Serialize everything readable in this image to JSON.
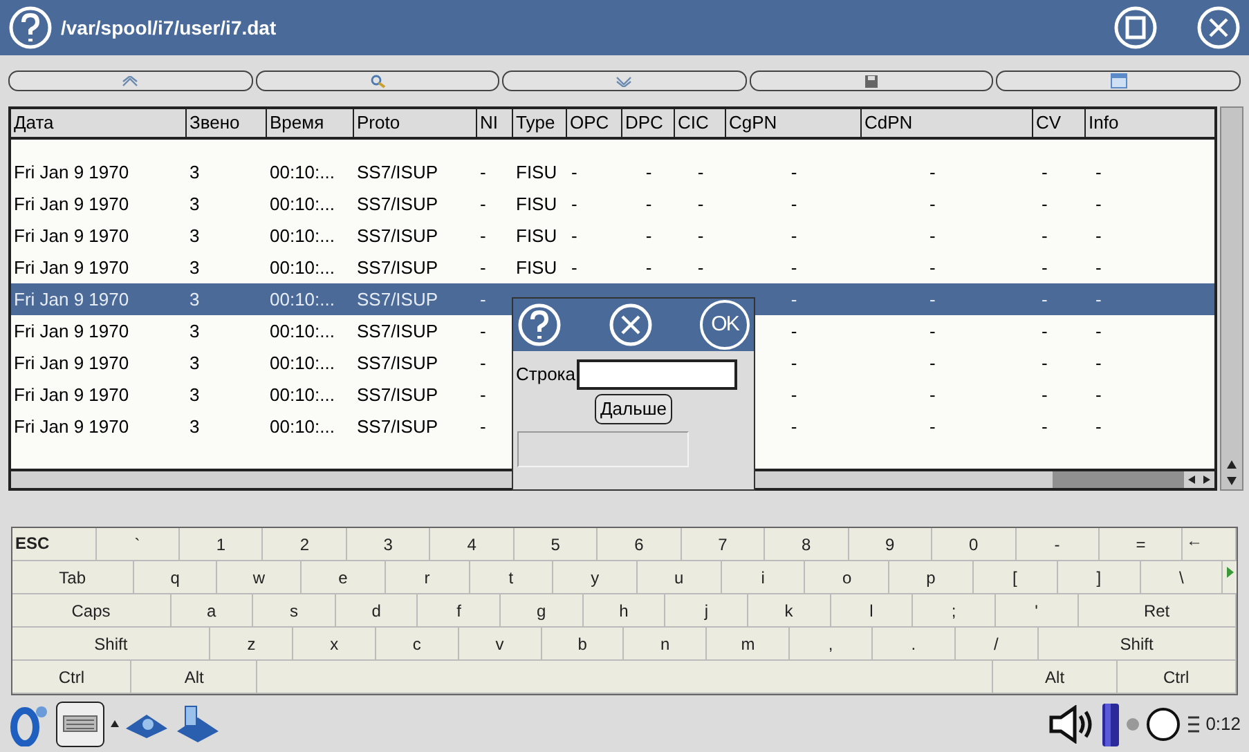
{
  "window": {
    "title": "/var/spool/i7/user/i7.dat"
  },
  "table": {
    "columns": [
      "Дата",
      "Звено",
      "Время",
      "Proto",
      "NI",
      "Type",
      "OPC",
      "DPC",
      "CIC",
      "CgPN",
      "CdPN",
      "CV",
      "Info"
    ],
    "rows": [
      {
        "selected": false,
        "cells": [
          "Fri Jan 9 1970",
          "3",
          "00:10:...",
          "SS7/ISUP",
          "-",
          "FISU",
          "-",
          "-",
          "-",
          "-",
          "-",
          "-",
          "-"
        ]
      },
      {
        "selected": false,
        "cells": [
          "Fri Jan 9 1970",
          "3",
          "00:10:...",
          "SS7/ISUP",
          "-",
          "FISU",
          "-",
          "-",
          "-",
          "-",
          "-",
          "-",
          "-"
        ]
      },
      {
        "selected": false,
        "cells": [
          "Fri Jan 9 1970",
          "3",
          "00:10:...",
          "SS7/ISUP",
          "-",
          "FISU",
          "-",
          "-",
          "-",
          "-",
          "-",
          "-",
          "-"
        ]
      },
      {
        "selected": false,
        "cells": [
          "Fri Jan 9 1970",
          "3",
          "00:10:...",
          "SS7/ISUP",
          "-",
          "FISU",
          "-",
          "-",
          "-",
          "-",
          "-",
          "-",
          "-"
        ]
      },
      {
        "selected": true,
        "cells": [
          "Fri Jan 9 1970",
          "3",
          "00:10:...",
          "SS7/ISUP",
          "-",
          null,
          null,
          null,
          null,
          "-",
          "-",
          "-",
          "-"
        ]
      },
      {
        "selected": false,
        "cells": [
          "Fri Jan 9 1970",
          "3",
          "00:10:...",
          "SS7/ISUP",
          "-",
          null,
          null,
          null,
          null,
          "-",
          "-",
          "-",
          "-"
        ]
      },
      {
        "selected": false,
        "cells": [
          "Fri Jan 9 1970",
          "3",
          "00:10:...",
          "SS7/ISUP",
          "-",
          null,
          null,
          null,
          null,
          "-",
          "-",
          "-",
          "-"
        ]
      },
      {
        "selected": false,
        "cells": [
          "Fri Jan 9 1970",
          "3",
          "00:10:...",
          "SS7/ISUP",
          "-",
          null,
          null,
          null,
          null,
          "-",
          "-",
          "-",
          "-"
        ]
      },
      {
        "selected": false,
        "cells": [
          "Fri Jan 9 1970",
          "3",
          "00:10:...",
          "SS7/ISUP",
          "-",
          null,
          null,
          null,
          null,
          "-",
          "-",
          "-",
          "-"
        ]
      }
    ]
  },
  "dialog": {
    "ok": "OK",
    "label": "Строка",
    "button": "Дальше"
  },
  "keyboard": {
    "rows": [
      [
        "ESC",
        "`",
        "1",
        "2",
        "3",
        "4",
        "5",
        "6",
        "7",
        "8",
        "9",
        "0",
        "-",
        "=",
        "←"
      ],
      [
        "Tab",
        "q",
        "w",
        "e",
        "r",
        "t",
        "y",
        "u",
        "i",
        "o",
        "p",
        "[",
        "]",
        "\\"
      ],
      [
        "Caps",
        "a",
        "s",
        "d",
        "f",
        "g",
        "h",
        "j",
        "k",
        "l",
        ";",
        "'",
        "Ret"
      ],
      [
        "Shift",
        "z",
        "x",
        "c",
        "v",
        "b",
        "n",
        "m",
        ",",
        ".",
        "/",
        "Shift"
      ],
      [
        "Ctrl",
        "Alt",
        "",
        "Alt",
        "Ctrl"
      ]
    ]
  },
  "taskbar": {
    "clock": "0:12"
  }
}
